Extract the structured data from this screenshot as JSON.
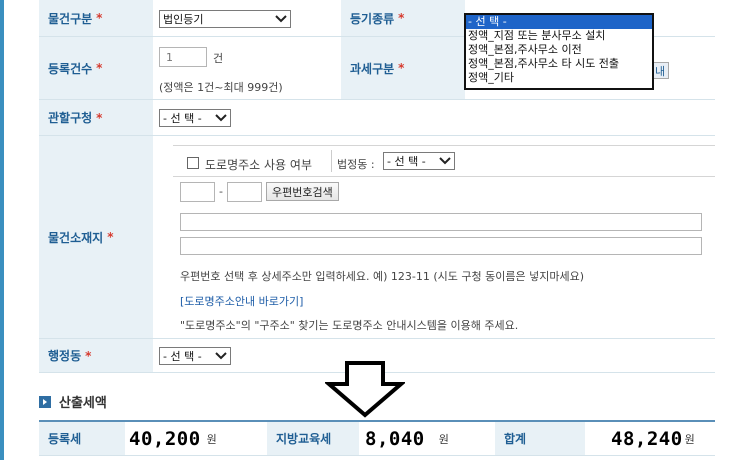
{
  "form": {
    "property_type": {
      "label": "물건구분",
      "required": "*",
      "value": "법인등기"
    },
    "registration_type": {
      "label": "등기종류",
      "required": "*",
      "selected": "- 선 택 -",
      "options": [
        "- 선 택 -",
        "정액_지점 또는 분사무소 설치",
        "정액_본점,주사무소 이전",
        "정액_본점,주사무소 타 시도 전출",
        "정액_기타"
      ]
    },
    "registration_count": {
      "label": "등록건수",
      "required": "*",
      "value": "1",
      "unit": "건",
      "hint": "(정액은 1건~최대 999건)"
    },
    "tax_type": {
      "label": "과세구분",
      "required": "*",
      "btn_fragment": "내"
    },
    "jurisdiction": {
      "label": "관할구청",
      "required": "*",
      "selected": "- 선 택 -"
    },
    "location": {
      "label": "물건소재지",
      "required": "*",
      "road_addr_checkbox_label": "도로명주소 사용 여부",
      "legal_dong_label": "법정동 :",
      "legal_dong_selected": "- 선 택 -",
      "zip_dash": "-",
      "zip_search_button": "우편번호검색",
      "help_text": "우편번호 선택 후 상세주소만 입력하세요. 예) 123-11 (시도 구청 동이름은 넣지마세요)",
      "road_link": "[도로명주소안내 바로가기]",
      "road_note": "\"도로명주소\"의 \"구주소\" 찾기는 도로명주소 안내시스템을 이용해 주세요."
    },
    "admin_dong": {
      "label": "행정동",
      "required": "*",
      "selected": "- 선 택 -"
    }
  },
  "result": {
    "section_title": "산출세액",
    "registration_tax": {
      "label": "등록세",
      "value": "40,200",
      "unit": "원"
    },
    "education_tax": {
      "label": "지방교육세",
      "value": "8,040",
      "unit": "원"
    },
    "total": {
      "label": "합계",
      "value": "48,240",
      "unit": "원"
    }
  },
  "colors": {
    "label_bg": "#e8f1f6",
    "label_text": "#1f5e93",
    "required": "#d63b2f",
    "selected_option": "#1e64c8"
  }
}
